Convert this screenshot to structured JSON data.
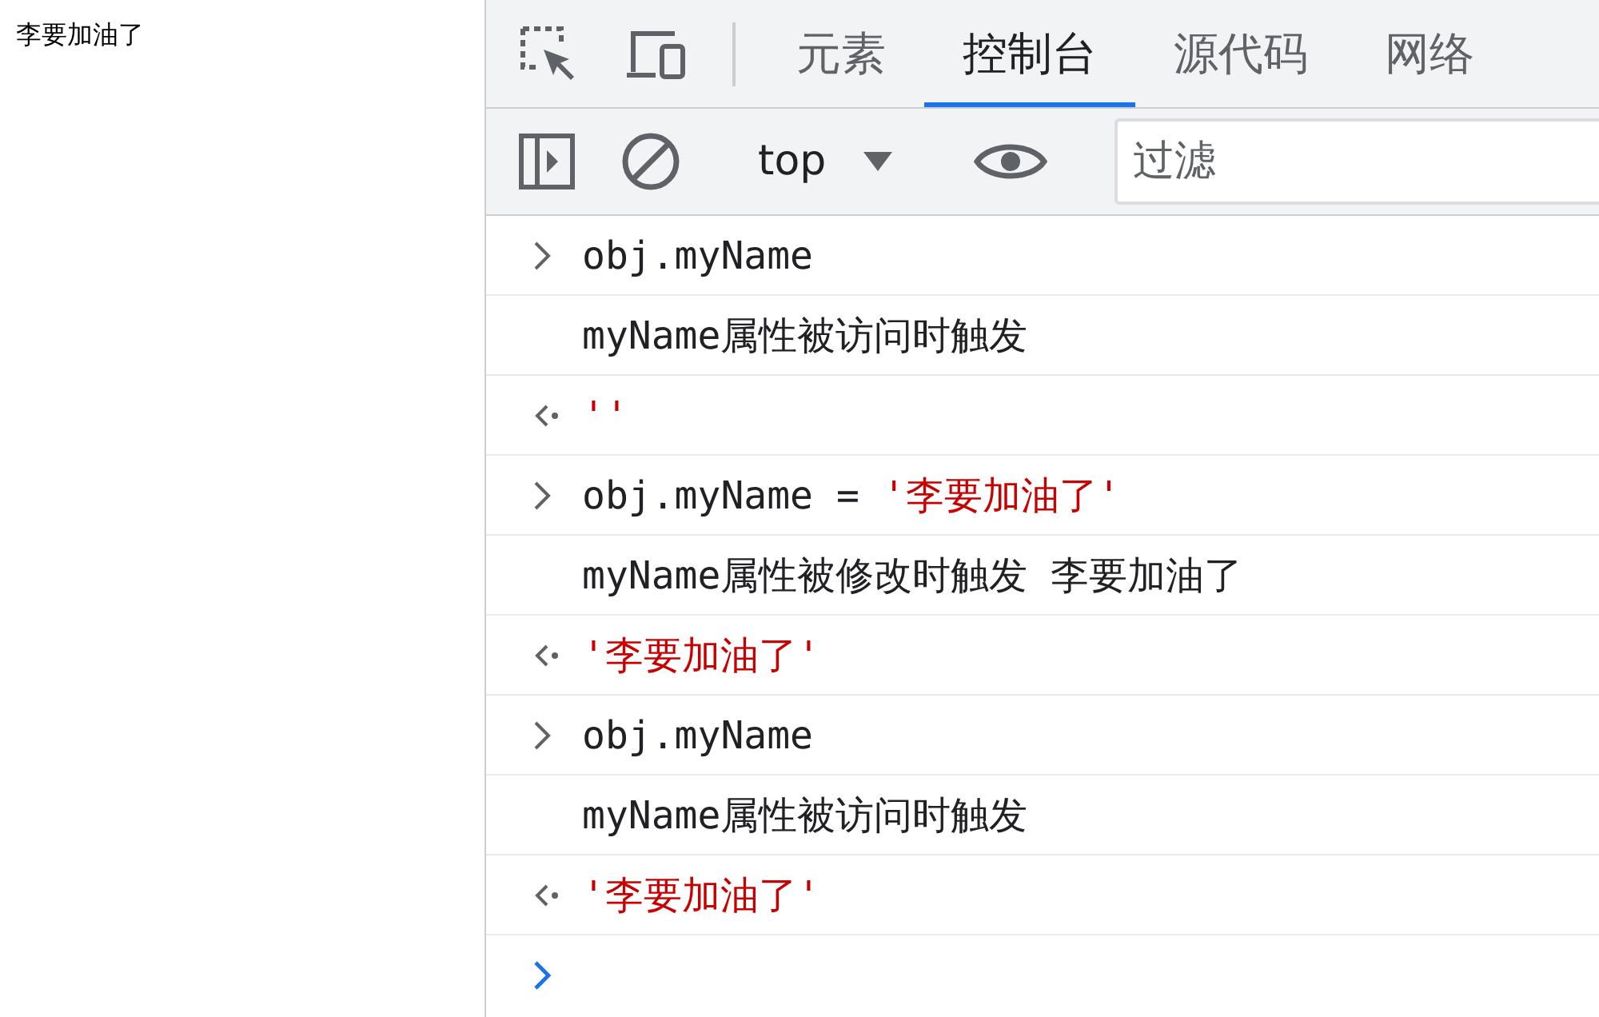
{
  "page": {
    "text": "李要加油了"
  },
  "devtools": {
    "tabs": [
      {
        "label": "元素",
        "selected": false
      },
      {
        "label": "控制台",
        "selected": true
      },
      {
        "label": "源代码",
        "selected": false
      },
      {
        "label": "网络",
        "selected": false
      }
    ],
    "toolbar": {
      "context": "top",
      "filter": {
        "placeholder": "过滤"
      }
    },
    "console": [
      {
        "kind": "input",
        "parts": [
          {
            "kind": "code",
            "text": "obj.myName"
          }
        ]
      },
      {
        "kind": "log",
        "parts": [
          {
            "kind": "code",
            "text": "myName属性被访问时触发"
          }
        ]
      },
      {
        "kind": "result",
        "parts": [
          {
            "kind": "string",
            "text": "''"
          }
        ]
      },
      {
        "kind": "input",
        "parts": [
          {
            "kind": "code",
            "text": "obj.myName = "
          },
          {
            "kind": "string",
            "text": "'李要加油了'"
          }
        ]
      },
      {
        "kind": "log",
        "parts": [
          {
            "kind": "code",
            "text": "myName属性被修改时触发 李要加油了"
          }
        ]
      },
      {
        "kind": "result",
        "parts": [
          {
            "kind": "string",
            "text": "'李要加油了'"
          }
        ]
      },
      {
        "kind": "input",
        "parts": [
          {
            "kind": "code",
            "text": "obj.myName"
          }
        ]
      },
      {
        "kind": "log",
        "parts": [
          {
            "kind": "code",
            "text": "myName属性被访问时触发"
          }
        ]
      },
      {
        "kind": "result",
        "parts": [
          {
            "kind": "string",
            "text": "'李要加油了'"
          }
        ]
      },
      {
        "kind": "prompt"
      }
    ]
  }
}
